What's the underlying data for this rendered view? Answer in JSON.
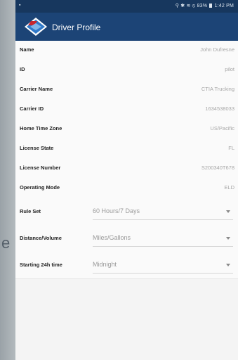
{
  "background": {
    "edge_letter": "e"
  },
  "status_bar": {
    "left_indicator": "▪",
    "icons": "⚲ ✱ ≋ ⦸",
    "battery": "83%",
    "time": "1:42 PM"
  },
  "app_bar": {
    "title": "Driver Profile",
    "logo_icon": "company-logo-icon"
  },
  "profile": {
    "rows": [
      {
        "label": "Name",
        "value": "John Dufresne"
      },
      {
        "label": "ID",
        "value": "pilot"
      },
      {
        "label": "Carrier Name",
        "value": "CTIA Trucking"
      },
      {
        "label": "Carrier ID",
        "value": "1634538033"
      },
      {
        "label": "Home Time Zone",
        "value": "US/Pacific"
      },
      {
        "label": "License State",
        "value": "FL"
      },
      {
        "label": "License Number",
        "value": "S200340T678"
      },
      {
        "label": "Operating Mode",
        "value": "ELD"
      }
    ],
    "dropdowns": [
      {
        "label": "Rule Set",
        "value": "60 Hours/7 Days"
      },
      {
        "label": "Distance/Volume",
        "value": "Miles/Gallons"
      },
      {
        "label": "Starting 24h time",
        "value": "Midnight"
      }
    ]
  },
  "colors": {
    "status_bar": "#17375e",
    "app_bar": "#1c4476",
    "logo_blue": "#2f79c9",
    "logo_red": "#c8262d"
  }
}
